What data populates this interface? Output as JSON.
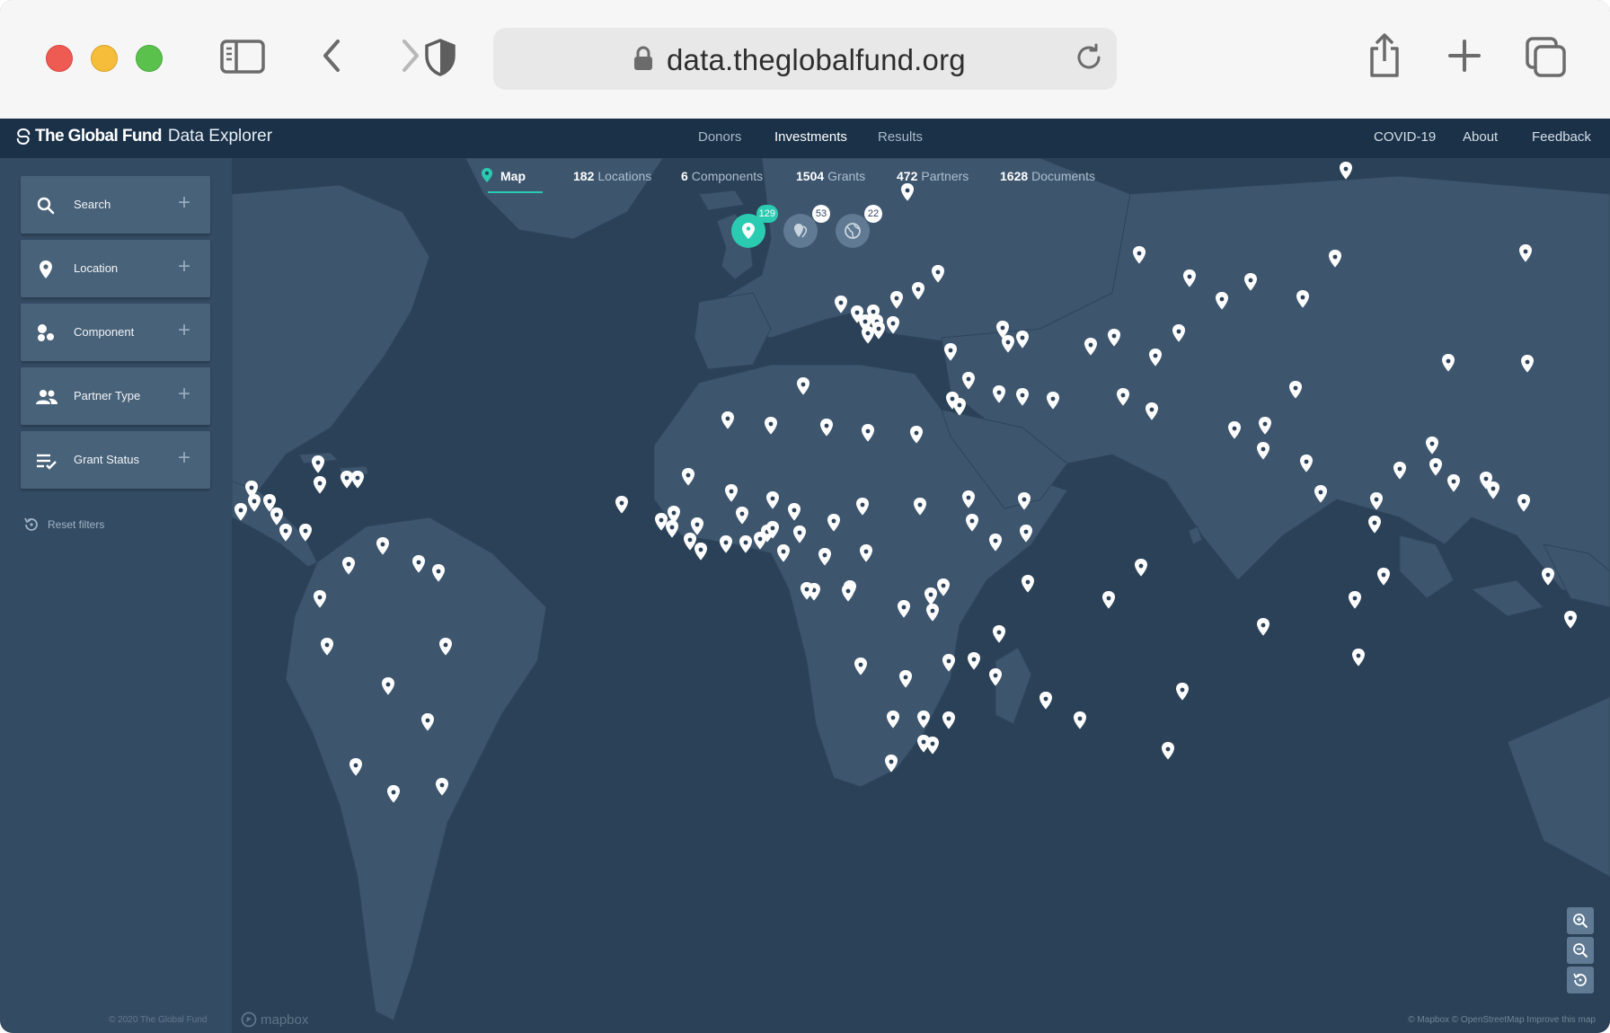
{
  "browser": {
    "url": "data.theglobalfund.org",
    "icons": [
      "sidebar-icon",
      "back-icon",
      "forward-icon",
      "shield-icon",
      "lock-icon",
      "reload-icon",
      "share-icon",
      "new-tab-icon",
      "tabs-icon"
    ]
  },
  "header": {
    "brand_name": "The Global Fund",
    "brand_suffix": "Data Explorer",
    "nav": [
      {
        "label": "Donors",
        "active": false
      },
      {
        "label": "Investments",
        "active": true
      },
      {
        "label": "Results",
        "active": false
      }
    ],
    "right_nav": [
      "COVID-19",
      "About",
      "Feedback"
    ]
  },
  "sidebar": {
    "filters": [
      {
        "label": "Search",
        "icon": "search-icon"
      },
      {
        "label": "Location",
        "icon": "location-pin-icon"
      },
      {
        "label": "Component",
        "icon": "component-icon"
      },
      {
        "label": "Partner Type",
        "icon": "people-icon"
      },
      {
        "label": "Grant Status",
        "icon": "list-check-icon"
      }
    ],
    "plus_symbol": "+",
    "reset_label": "Reset filters",
    "copyright": "© 2020 The Global Fund"
  },
  "tabs": {
    "map": "Map",
    "items": [
      {
        "count": "182",
        "label": "Locations"
      },
      {
        "count": "6",
        "label": "Components"
      },
      {
        "count": "1504",
        "label": "Grants"
      },
      {
        "count": "472",
        "label": "Partners"
      },
      {
        "count": "1628",
        "label": "Documents"
      }
    ]
  },
  "map": {
    "clusters": [
      {
        "count": "129",
        "kind": "country",
        "color": "#2bcbb1"
      },
      {
        "count": "53",
        "kind": "multi-country",
        "color": "#5f7a92"
      },
      {
        "count": "22",
        "kind": "global",
        "color": "#5f7a92"
      }
    ],
    "mapbox_label": "mapbox",
    "attribution": "© Mapbox © OpenStreetMap Improve this map",
    "colors": {
      "ocean": "#2b4157",
      "land": "#3d566e",
      "pin": "#ffffff",
      "accent": "#2bcbb1"
    }
  }
}
